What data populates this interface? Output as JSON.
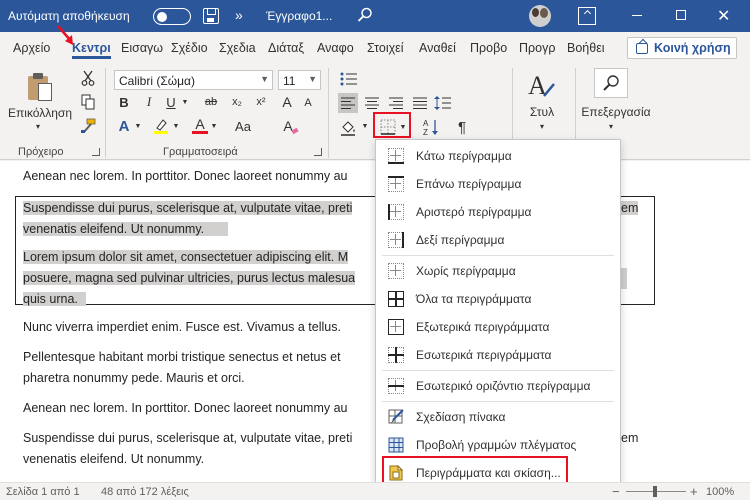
{
  "titlebar": {
    "autosave_label": "Αυτόματη αποθήκευση",
    "more_label": "»",
    "document_title": "Έγγραφο1...",
    "close_glyph": "✕"
  },
  "tabs": [
    {
      "label": "Αρχείο"
    },
    {
      "label": "Κεντρι"
    },
    {
      "label": "Εισαγω"
    },
    {
      "label": "Σχέδιο"
    },
    {
      "label": "Σχεδιa"
    },
    {
      "label": "Διάταξ"
    },
    {
      "label": "Αναφο"
    },
    {
      "label": "Στοιχεί"
    },
    {
      "label": "Αναθεί"
    },
    {
      "label": "Προβο"
    },
    {
      "label": "Προγρ"
    },
    {
      "label": "Βοήθει"
    }
  ],
  "share_label": "Κοινή χρήση",
  "ribbon": {
    "paste_label": "Επικόλληση",
    "font_name": "Calibri (Σώμα)",
    "font_size": "11",
    "bold": "B",
    "italic": "I",
    "underline": "U",
    "strike": "ab",
    "subscript": "x₂",
    "superscript": "x²",
    "clear_format": "A",
    "grow_font": "A",
    "shrink_font": "A",
    "change_case": "Aa",
    "text_effects": "A",
    "font_color": "A",
    "pilcrow": "¶",
    "styles_label": "Στυλ",
    "editing_label": "Επεξεργασία",
    "groups": {
      "clipboard": "Πρόχειρο",
      "font": "Γραμματοσειρά"
    }
  },
  "document": {
    "lines": [
      "Aenean nec lorem. In porttitor. Donec laoreet nonummy au",
      "Suspendisse dui purus, scelerisque at, vulputate vitae, preti",
      "venenatis eleifend. Ut nonummy.",
      "Lorem ipsum dolor sit amet, consectetuer adipiscing elit. M",
      "posuere, magna sed pulvinar ultricies, purus lectus malesua",
      "quis urna.",
      "Nunc viverra imperdiet enim. Fusce est. Vivamus a tellus.",
      "Pellentesque habitant morbi tristique senectus et netus et",
      "pharetra nonummy pede. Mauris et orci.",
      "Aenean nec lorem. In porttitor. Donec laoreet nonummy au",
      "Suspendisse dui purus, scelerisque at, vulputate vitae, preti",
      "venenatis eleifend. Ut nonummy."
    ],
    "right_overflow": [
      "em",
      "em"
    ]
  },
  "borders_menu": {
    "items": [
      {
        "label": "Κάτω περίγραμμα",
        "icon": "bottom-border-icon"
      },
      {
        "label": "Επάνω περίγραμμα",
        "icon": "top-border-icon"
      },
      {
        "label": "Αριστερό περίγραμμα",
        "icon": "left-border-icon"
      },
      {
        "label": "Δεξί περίγραμμα",
        "icon": "right-border-icon"
      },
      {
        "label": "Χωρίς περίγραμμα",
        "icon": "no-border-icon"
      },
      {
        "label": "Όλα τα περιγράμματα",
        "icon": "all-borders-icon"
      },
      {
        "label": "Εξωτερικά περιγράμματα",
        "icon": "outside-borders-icon"
      },
      {
        "label": "Εσωτερικά περιγράμματα",
        "icon": "inside-borders-icon"
      },
      {
        "label": "Εσωτερικό οριζόντιο περίγραμμα",
        "icon": "inside-horizontal-border-icon"
      },
      {
        "label": "Σχεδίαση πίνακα",
        "icon": "draw-table-icon"
      },
      {
        "label": "Προβολή γραμμών πλέγματος",
        "icon": "view-gridlines-icon"
      },
      {
        "label": "Περιγράμματα και σκίαση...",
        "icon": "borders-and-shading-icon"
      }
    ]
  },
  "statusbar": {
    "page": "Σελίδα 1 από 1",
    "words": "48 από 172 λέξεις",
    "zoom_minus": "−",
    "zoom_plus": "+",
    "zoom": "100%"
  },
  "colors": {
    "title_blue": "#2b579a",
    "highlight_yellow": "#ffff00",
    "font_red": "#e81123",
    "selection_gray": "#d2d0ce",
    "callout_red": "#e81123"
  }
}
